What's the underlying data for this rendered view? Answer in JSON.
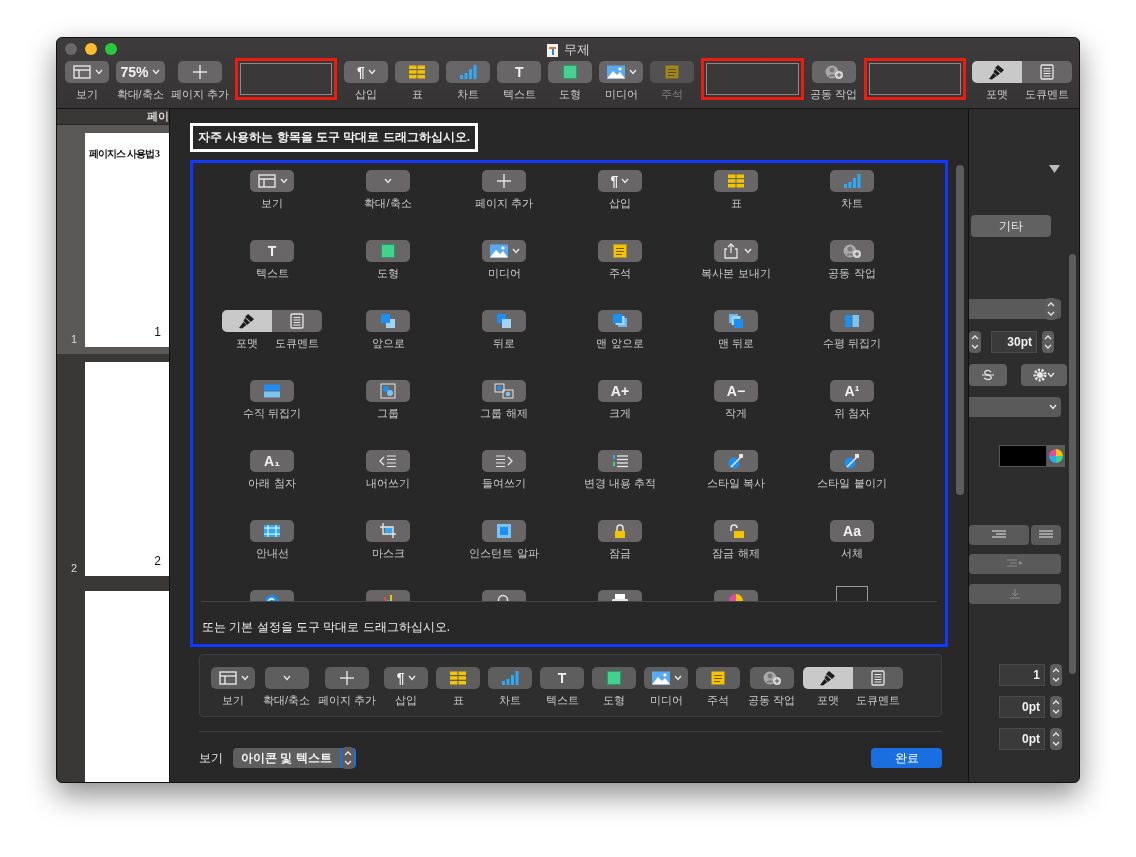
{
  "window": {
    "title": "무제"
  },
  "toolbar": {
    "items": [
      {
        "kind": "dropdown",
        "label": "보기",
        "disabled": false
      },
      {
        "kind": "dropdown",
        "label": "확대/축소",
        "value": "75%",
        "disabled": false
      },
      {
        "kind": "button",
        "label": "페이지 추가",
        "disabled": false
      },
      {
        "kind": "slot"
      },
      {
        "kind": "dropdown",
        "label": "삽입",
        "glyph": "¶",
        "disabled": false
      },
      {
        "kind": "button",
        "label": "표",
        "disabled": false
      },
      {
        "kind": "button",
        "label": "차트",
        "disabled": false
      },
      {
        "kind": "button",
        "label": "텍스트",
        "glyph": "T",
        "disabled": false
      },
      {
        "kind": "button",
        "label": "도형",
        "disabled": false
      },
      {
        "kind": "dropdown",
        "label": "미디어",
        "disabled": false
      },
      {
        "kind": "button",
        "label": "주석",
        "disabled": true
      },
      {
        "kind": "slot"
      },
      {
        "kind": "button",
        "label": "공동 작업",
        "disabled": false
      },
      {
        "kind": "slot"
      },
      {
        "kind": "segmented",
        "segments": [
          {
            "label": "포맷",
            "selected": true
          },
          {
            "label": "도큐멘트",
            "selected": false
          }
        ]
      }
    ]
  },
  "sidebar": {
    "header": "페이",
    "pages": [
      {
        "number": "1",
        "title": "페이지스 사용법 3",
        "page_number": "1",
        "selected": true
      },
      {
        "number": "2",
        "page_number": "2",
        "selected": false
      },
      {
        "selected": false
      }
    ]
  },
  "sheet": {
    "instruction": "자주 사용하는 항목을 도구 막대로 드래그하십시오.",
    "palette": [
      {
        "kind": "dropdown",
        "label": "보기"
      },
      {
        "kind": "dropdown",
        "label": "확대/축소"
      },
      {
        "kind": "button",
        "label": "페이지 추가"
      },
      {
        "kind": "dropdown",
        "label": "삽입",
        "glyph": "¶"
      },
      {
        "kind": "button",
        "label": "표"
      },
      {
        "kind": "button",
        "label": "차트"
      },
      {
        "kind": "button",
        "label": "텍스트",
        "glyph": "T"
      },
      {
        "kind": "button",
        "label": "도형"
      },
      {
        "kind": "dropdown",
        "label": "미디어"
      },
      {
        "kind": "button",
        "label": "주석"
      },
      {
        "kind": "dropdown",
        "label": "복사본 보내기"
      },
      {
        "kind": "button",
        "label": "공동 작업"
      },
      {
        "kind": "segmented",
        "segments": [
          {
            "label": "포맷",
            "selected": true
          },
          {
            "label": "도큐멘트",
            "selected": false
          }
        ]
      },
      {
        "kind": "button",
        "label": "앞으로"
      },
      {
        "kind": "button",
        "label": "뒤로"
      },
      {
        "kind": "button",
        "label": "맨 앞으로"
      },
      {
        "kind": "button",
        "label": "맨 뒤로"
      },
      {
        "kind": "button",
        "label": "수평 뒤집기"
      },
      {
        "kind": "button",
        "label": "수직 뒤집기"
      },
      {
        "kind": "button",
        "label": "그룹"
      },
      {
        "kind": "button",
        "label": "그룹 해제"
      },
      {
        "kind": "button",
        "label": "크게",
        "glyph": "A+"
      },
      {
        "kind": "button",
        "label": "작게",
        "glyph": "A−"
      },
      {
        "kind": "button",
        "label": "위 첨자",
        "glyph": "A¹"
      },
      {
        "kind": "button",
        "label": "아래 첨자",
        "glyph": "A₁"
      },
      {
        "kind": "button",
        "label": "내어쓰기"
      },
      {
        "kind": "button",
        "label": "들여쓰기"
      },
      {
        "kind": "button",
        "label": "변경 내용 추적"
      },
      {
        "kind": "button",
        "label": "스타일 복사"
      },
      {
        "kind": "button",
        "label": "스타일 붙이기"
      },
      {
        "kind": "button",
        "label": "안내선"
      },
      {
        "kind": "button",
        "label": "마스크"
      },
      {
        "kind": "button",
        "label": "인스턴트 알파"
      },
      {
        "kind": "button",
        "label": "잠금"
      },
      {
        "kind": "button",
        "label": "잠금 해제"
      },
      {
        "kind": "button",
        "label": "서체",
        "glyph": "Aa"
      },
      {
        "kind": "button"
      },
      {
        "kind": "button"
      },
      {
        "kind": "button"
      },
      {
        "kind": "button"
      },
      {
        "kind": "button"
      },
      {
        "kind": "space"
      }
    ],
    "default_hint": "또는 기본 설정을 도구 막대로 드래그하십시오.",
    "default_set": [
      {
        "kind": "dropdown",
        "label": "보기",
        "disabled": false
      },
      {
        "kind": "dropdown",
        "label": "확대/축소",
        "disabled": false
      },
      {
        "kind": "button",
        "label": "페이지 추가",
        "disabled": false
      },
      {
        "kind": "dropdown",
        "label": "삽입",
        "glyph": "¶",
        "disabled": false
      },
      {
        "kind": "button",
        "label": "표",
        "disabled": false
      },
      {
        "kind": "button",
        "label": "차트",
        "disabled": false
      },
      {
        "kind": "button",
        "label": "텍스트",
        "glyph": "T",
        "disabled": false
      },
      {
        "kind": "button",
        "label": "도형",
        "disabled": false
      },
      {
        "kind": "dropdown",
        "label": "미디어",
        "disabled": false
      },
      {
        "kind": "button",
        "label": "주석",
        "disabled": false
      },
      {
        "kind": "button",
        "label": "공동 작업",
        "disabled": false
      },
      {
        "kind": "segmented",
        "segments": [
          {
            "label": "포맷",
            "selected": true
          },
          {
            "label": "도큐멘트",
            "selected": false
          }
        ]
      }
    ],
    "show_label": "보기",
    "show_value": "아이콘 및 텍스트",
    "done": "완료"
  },
  "inspector": {
    "tab": "기타",
    "size": "30pt",
    "fields": [
      "1",
      "0pt",
      "0pt"
    ]
  }
}
